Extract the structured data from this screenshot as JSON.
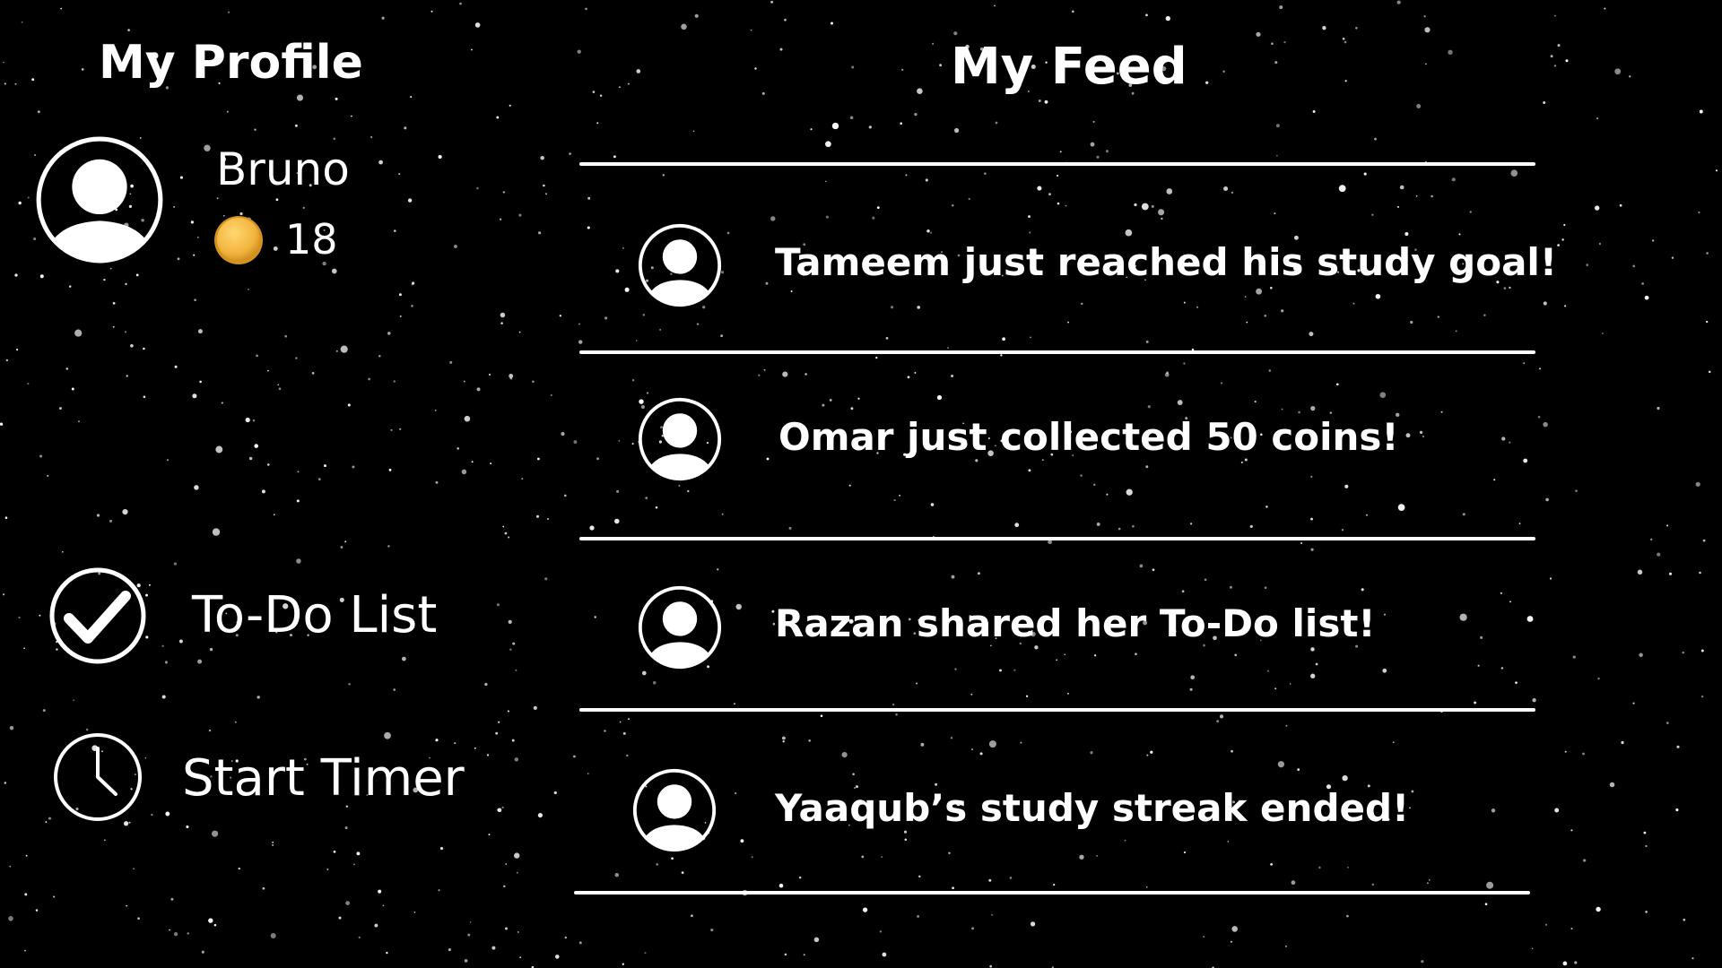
{
  "profile": {
    "heading": "My Profile",
    "username": "Bruno",
    "coins": "18"
  },
  "nav": {
    "todo_label": "To-Do List",
    "timer_label": "Start Timer"
  },
  "feed": {
    "heading": "My Feed",
    "items": [
      {
        "text": "Tameem just reached his study goal!"
      },
      {
        "text": "Omar just collected 50 coins!"
      },
      {
        "text": "Razan shared her To-Do list!"
      },
      {
        "text": "Yaaqub’s study streak ended!"
      }
    ]
  },
  "colors": {
    "background": "#000000",
    "foreground": "#ffffff",
    "coin": "#f2b33d"
  },
  "icons": {
    "avatar": "user-avatar-icon",
    "coin": "coin-icon",
    "todo": "checkmark-circle-icon",
    "timer": "clock-icon"
  }
}
